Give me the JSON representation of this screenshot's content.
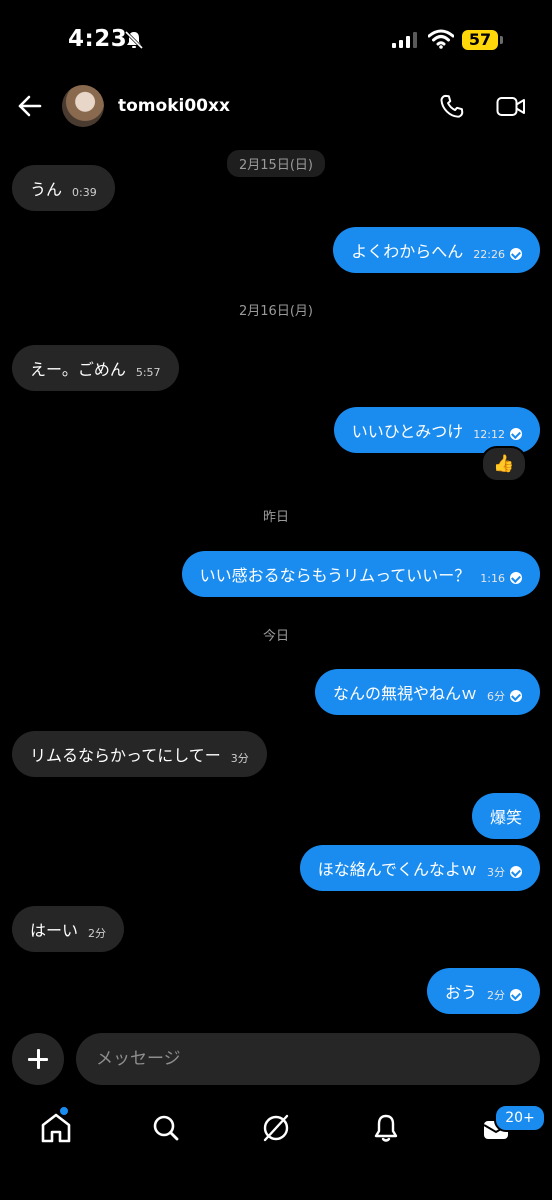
{
  "status_bar": {
    "time": "4:23",
    "battery": "57"
  },
  "header": {
    "username": "tomoki00xx"
  },
  "thread": {
    "separators": [
      "2月15日(日)",
      "2月16日(月)",
      "昨日",
      "今日"
    ],
    "messages": [
      {
        "side": "in",
        "text": "うん",
        "time": "0:39"
      },
      {
        "side": "out",
        "text": "よくわからへん",
        "time": "22:26"
      },
      {
        "side": "in",
        "text": "えー。ごめん",
        "time": "5:57"
      },
      {
        "side": "out",
        "text": "いいひとみつけ",
        "time": "12:12",
        "reaction": "👍"
      },
      {
        "side": "out",
        "text": "いい感おるならもうリムっていいー？",
        "time": "1:16"
      },
      {
        "side": "out",
        "text": "なんの無視やねんｗ",
        "time": "6分"
      },
      {
        "side": "in",
        "text": "リムるならかってにしてー",
        "time": "3分"
      },
      {
        "side": "out",
        "text": "爆笑",
        "time": ""
      },
      {
        "side": "out",
        "text": "ほな絡んでくんなよｗ",
        "time": "3分"
      },
      {
        "side": "in",
        "text": "はーい",
        "time": "2分"
      },
      {
        "side": "out",
        "text": "おう",
        "time": "2分"
      }
    ]
  },
  "composer": {
    "placeholder": "メッセージ"
  },
  "nav": {
    "inbox_badge": "20+"
  },
  "colors": {
    "accent": "#1a8cf0",
    "incoming_bubble": "#262626",
    "background": "#000000"
  }
}
